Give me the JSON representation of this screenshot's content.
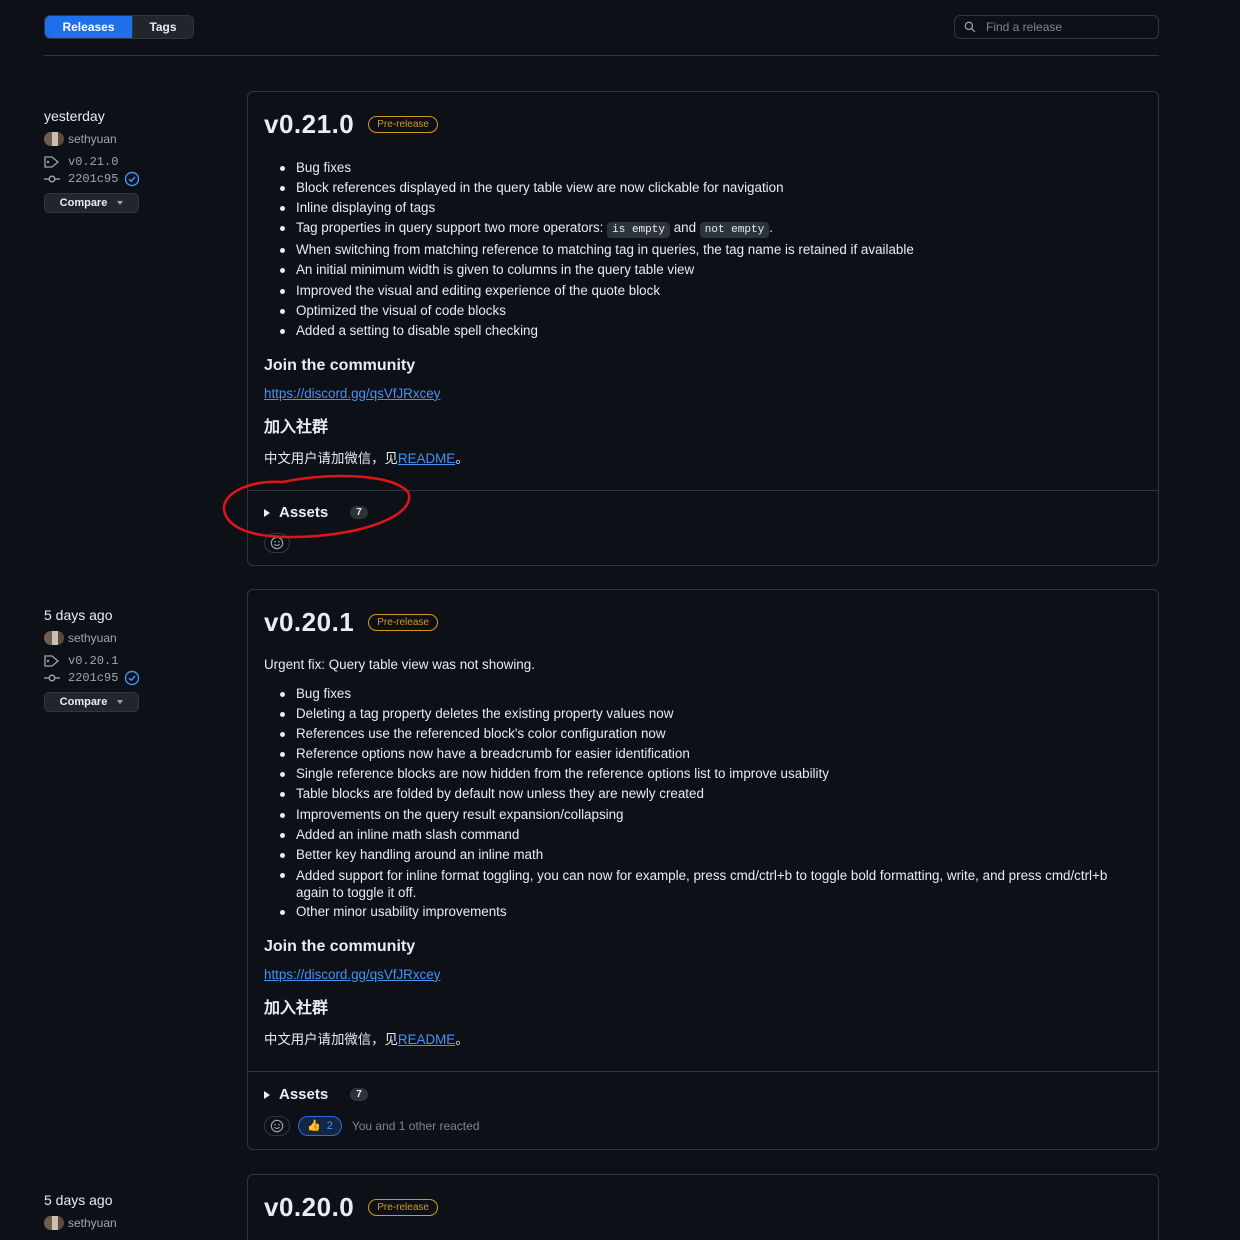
{
  "tabs": {
    "releases": "Releases",
    "tags": "Tags"
  },
  "search": {
    "placeholder": "Find a release"
  },
  "releases": [
    {
      "when": "yesterday",
      "author": "sethyuan",
      "tag": "v0.21.0",
      "commit": "2201c95",
      "compare_label": "Compare",
      "title": "v0.21.0",
      "badge": "Pre-release",
      "bullets": [
        "Bug fixes",
        "Block references displayed in the query table view are now clickable for navigation",
        "Inline displaying of tags",
        "Tag properties in query support two more operators:",
        "When switching from matching reference to matching tag in queries, the tag name is retained if available",
        "An initial minimum width is given to columns in the query table view",
        "Improved the visual and editing experience of the quote block",
        "Optimized the visual of code blocks",
        "Added a setting to disable spell checking"
      ],
      "operators": {
        "op1": "is empty",
        "and": "and",
        "op2": "not empty",
        "period": "."
      },
      "community_heading": "Join the community",
      "community_link": "https://discord.gg/qsVfJRxcey",
      "zh_heading": "加入社群",
      "zh_text": "中文用户请加微信，见",
      "zh_link": "README",
      "zh_end": "。",
      "assets_label": "Assets",
      "assets_count": "7"
    },
    {
      "when": "5 days ago",
      "author": "sethyuan",
      "tag": "v0.20.1",
      "commit": "2201c95",
      "compare_label": "Compare",
      "title": "v0.20.1",
      "badge": "Pre-release",
      "intro": "Urgent fix: Query table view was not showing.",
      "bullets": [
        "Bug fixes",
        "Deleting a tag property deletes the existing property values now",
        "References use the referenced block's color configuration now",
        "Reference options now have a breadcrumb for easier identification",
        "Single reference blocks are now hidden from the reference options list to improve usability",
        "Table blocks are folded by default now unless they are newly created",
        "Improvements on the query result expansion/collapsing",
        "Added an inline math slash command",
        "Better key handling around an inline math",
        "Added support for inline format toggling, you can now for example, press cmd/ctrl+b to toggle bold formatting, write, and press cmd/ctrl+b again to toggle it off.",
        "Other minor usability improvements"
      ],
      "community_heading": "Join the community",
      "community_link": "https://discord.gg/qsVfJRxcey",
      "zh_heading": "加入社群",
      "zh_text": "中文用户请加微信，见",
      "zh_link": "README",
      "zh_end": "。",
      "assets_label": "Assets",
      "assets_count": "7",
      "thumbs_count": "2",
      "reacted_text": "You and 1 other reacted"
    },
    {
      "when": "5 days ago",
      "author": "sethyuan",
      "title": "v0.20.0",
      "badge": "Pre-release"
    }
  ],
  "colors": {
    "accent": "#1f6feb",
    "prerelease": "#d29922",
    "link": "#4493f8",
    "annotation": "#e0151a"
  }
}
